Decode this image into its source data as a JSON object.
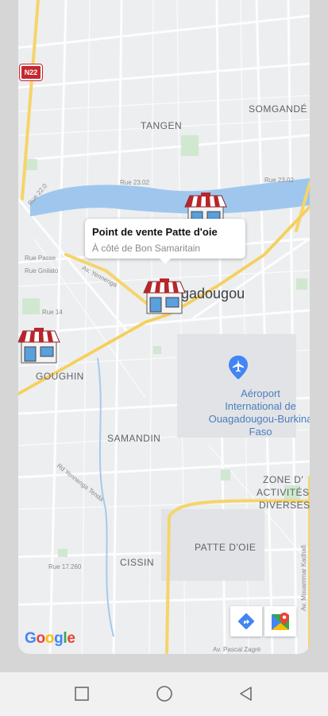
{
  "map": {
    "road_shield": "N22",
    "districts": {
      "tangen": "TANGEN",
      "somgande": "SOMGANDÉ",
      "goughin": "GOUGHIN",
      "samandin": "SAMANDIN",
      "zone_line1": "ZONE D'",
      "zone_line2": "ACTIVITÉS",
      "zone_line3": "DIVERSES",
      "patte_doie": "PATTE D'OIE",
      "cissin": "CISSIN"
    },
    "city_label": "gadougou",
    "airport": {
      "line1": "Aéroport",
      "line2": "International de",
      "line3": "Ouagadougou-Burkina",
      "line4": "Faso",
      "icon": "airplane-icon"
    },
    "streets": {
      "s1": "Rue 23.02",
      "s2": "Rue 23.02",
      "s3": "Rue 22.0",
      "s4": "Rue Gnilato",
      "s5": "Rue 14",
      "s6": "Rue Passe",
      "s7": "Av. Yennenga",
      "s8": "Rd Yennenga Tenda",
      "s9": "Rue 17.260",
      "s10": "Av. Pascal Zagré",
      "s11": "Av. Mouammar Kadhafi"
    },
    "google_logo": {
      "G": "G",
      "o1": "o",
      "o2": "o",
      "g": "g",
      "l": "l",
      "e": "e"
    },
    "colors": {
      "water": "#9fc7ee",
      "road": "#f6d46a",
      "park": "#cfe8cf",
      "marker_red": "#b7262b"
    }
  },
  "info_window": {
    "title": "Point de vente Patte d'oie",
    "subtitle": "À côté de Bon Samaritain"
  },
  "controls": {
    "directions_icon": "directions-icon",
    "maps_icon": "google-maps-icon"
  },
  "navbar": {
    "recents": "square-icon",
    "home": "circle-icon",
    "back": "triangle-back-icon"
  }
}
